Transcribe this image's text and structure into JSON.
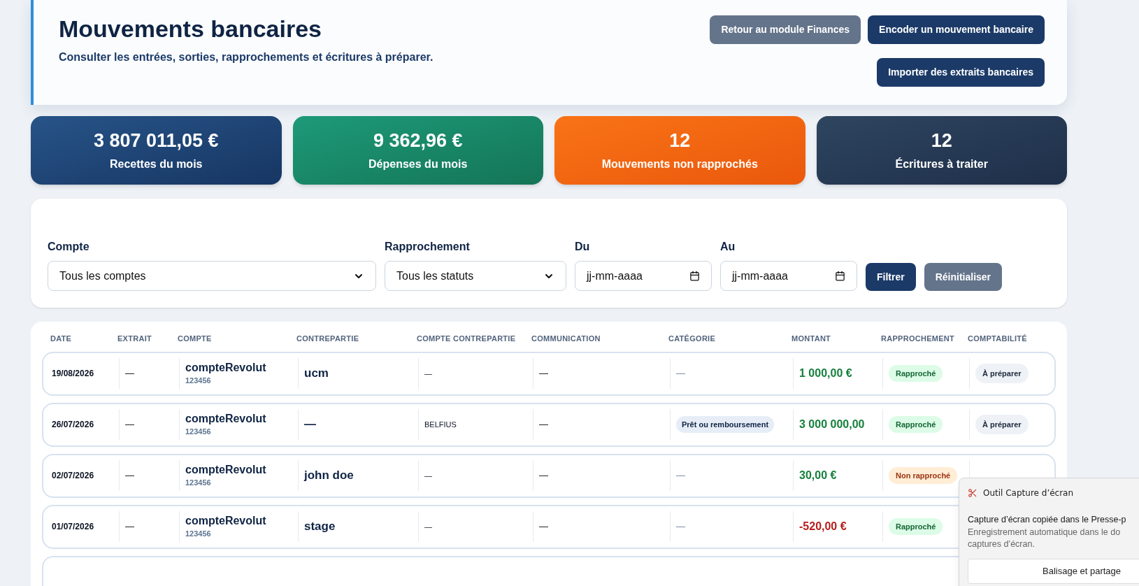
{
  "header": {
    "title": "Mouvements bancaires",
    "subtitle": "Consulter les entrées, sorties, rapprochements et écritures à préparer.",
    "buttons": [
      {
        "label": "Retour au module Finances",
        "kind": "secondary"
      },
      {
        "label": "Encoder un mouvement bancaire",
        "kind": "primary"
      },
      {
        "label": "Importer des extraits bancaires",
        "kind": "primary"
      }
    ]
  },
  "stats": [
    {
      "value": "3 807 011,05 €",
      "label": "Recettes du mois",
      "kind": "blue"
    },
    {
      "value": "9 362,96 €",
      "label": "Dépenses du mois",
      "kind": "green"
    },
    {
      "value": "12",
      "label": "Mouvements non rapprochés",
      "kind": "orange"
    },
    {
      "value": "12",
      "label": "Écritures à traiter",
      "kind": "slate"
    }
  ],
  "filters": {
    "fields": [
      {
        "label": "Compte",
        "value": "Tous les comptes",
        "kind": "select"
      },
      {
        "label": "Rapprochement",
        "value": "Tous les statuts",
        "kind": "select"
      },
      {
        "label": "Du",
        "value": "jj-mm-aaaa",
        "kind": "date"
      },
      {
        "label": "Au",
        "value": "jj-mm-aaaa",
        "kind": "date"
      }
    ],
    "buttons": [
      {
        "label": "Filtrer",
        "kind": "primary"
      },
      {
        "label": "Réinitialiser",
        "kind": "secondary"
      }
    ]
  },
  "table": {
    "columns": [
      "DATE",
      "EXTRAIT",
      "COMPTE",
      "CONTREPARTIE",
      "COMPTE CONTREPARTIE",
      "COMMUNICATION",
      "CATÉGORIE",
      "MONTANT",
      "RAPPROCHEMENT",
      "COMPTABILITÉ"
    ],
    "rows": [
      {
        "date": "19/08/2026",
        "extrait": "—",
        "account": "compteRevolut",
        "account_number": "123456",
        "counterparty": "ucm",
        "counter_account": "—",
        "communication": "—",
        "category": {
          "kind": "dash",
          "text": "—"
        },
        "amount": {
          "kind": "credit",
          "text": "1 000,00 €"
        },
        "reconciliation": "Rapproché",
        "reconciled": true,
        "accounting": "À préparer"
      },
      {
        "date": "26/07/2026",
        "extrait": "—",
        "account": "compteRevolut",
        "account_number": "123456",
        "counterparty": "—",
        "counter_account": "BELFIUS",
        "communication": "—",
        "category": {
          "kind": "tag",
          "text": "Prêt ou remboursement"
        },
        "amount": {
          "kind": "credit",
          "text": "3 000 000,00"
        },
        "reconciliation": "Rapproché",
        "reconciled": true,
        "accounting": "À préparer"
      },
      {
        "date": "02/07/2026",
        "extrait": "—",
        "account": "compteRevolut",
        "account_number": "123456",
        "counterparty": "john doe",
        "counter_account": "—",
        "communication": "—",
        "category": {
          "kind": "dash",
          "text": "—"
        },
        "amount": {
          "kind": "credit",
          "text": "30,00 €"
        },
        "reconciliation": "Non rapproché",
        "reconciled": false
      },
      {
        "date": "01/07/2026",
        "extrait": "—",
        "account": "compteRevolut",
        "account_number": "123456",
        "counterparty": "stage",
        "counter_account": "—",
        "communication": "—",
        "category": {
          "kind": "dash",
          "text": "—"
        },
        "amount": {
          "kind": "debit",
          "text": "-520,00 €"
        },
        "reconciliation": "Rapproché",
        "reconciled": true
      }
    ]
  },
  "notification": {
    "app": "Outil Capture d’écran",
    "title": "Capture d’écran copiée dans le Presse-p",
    "body": "Enregistrement automatique dans le do captures d’écran.",
    "action": "Balisage et partage"
  }
}
